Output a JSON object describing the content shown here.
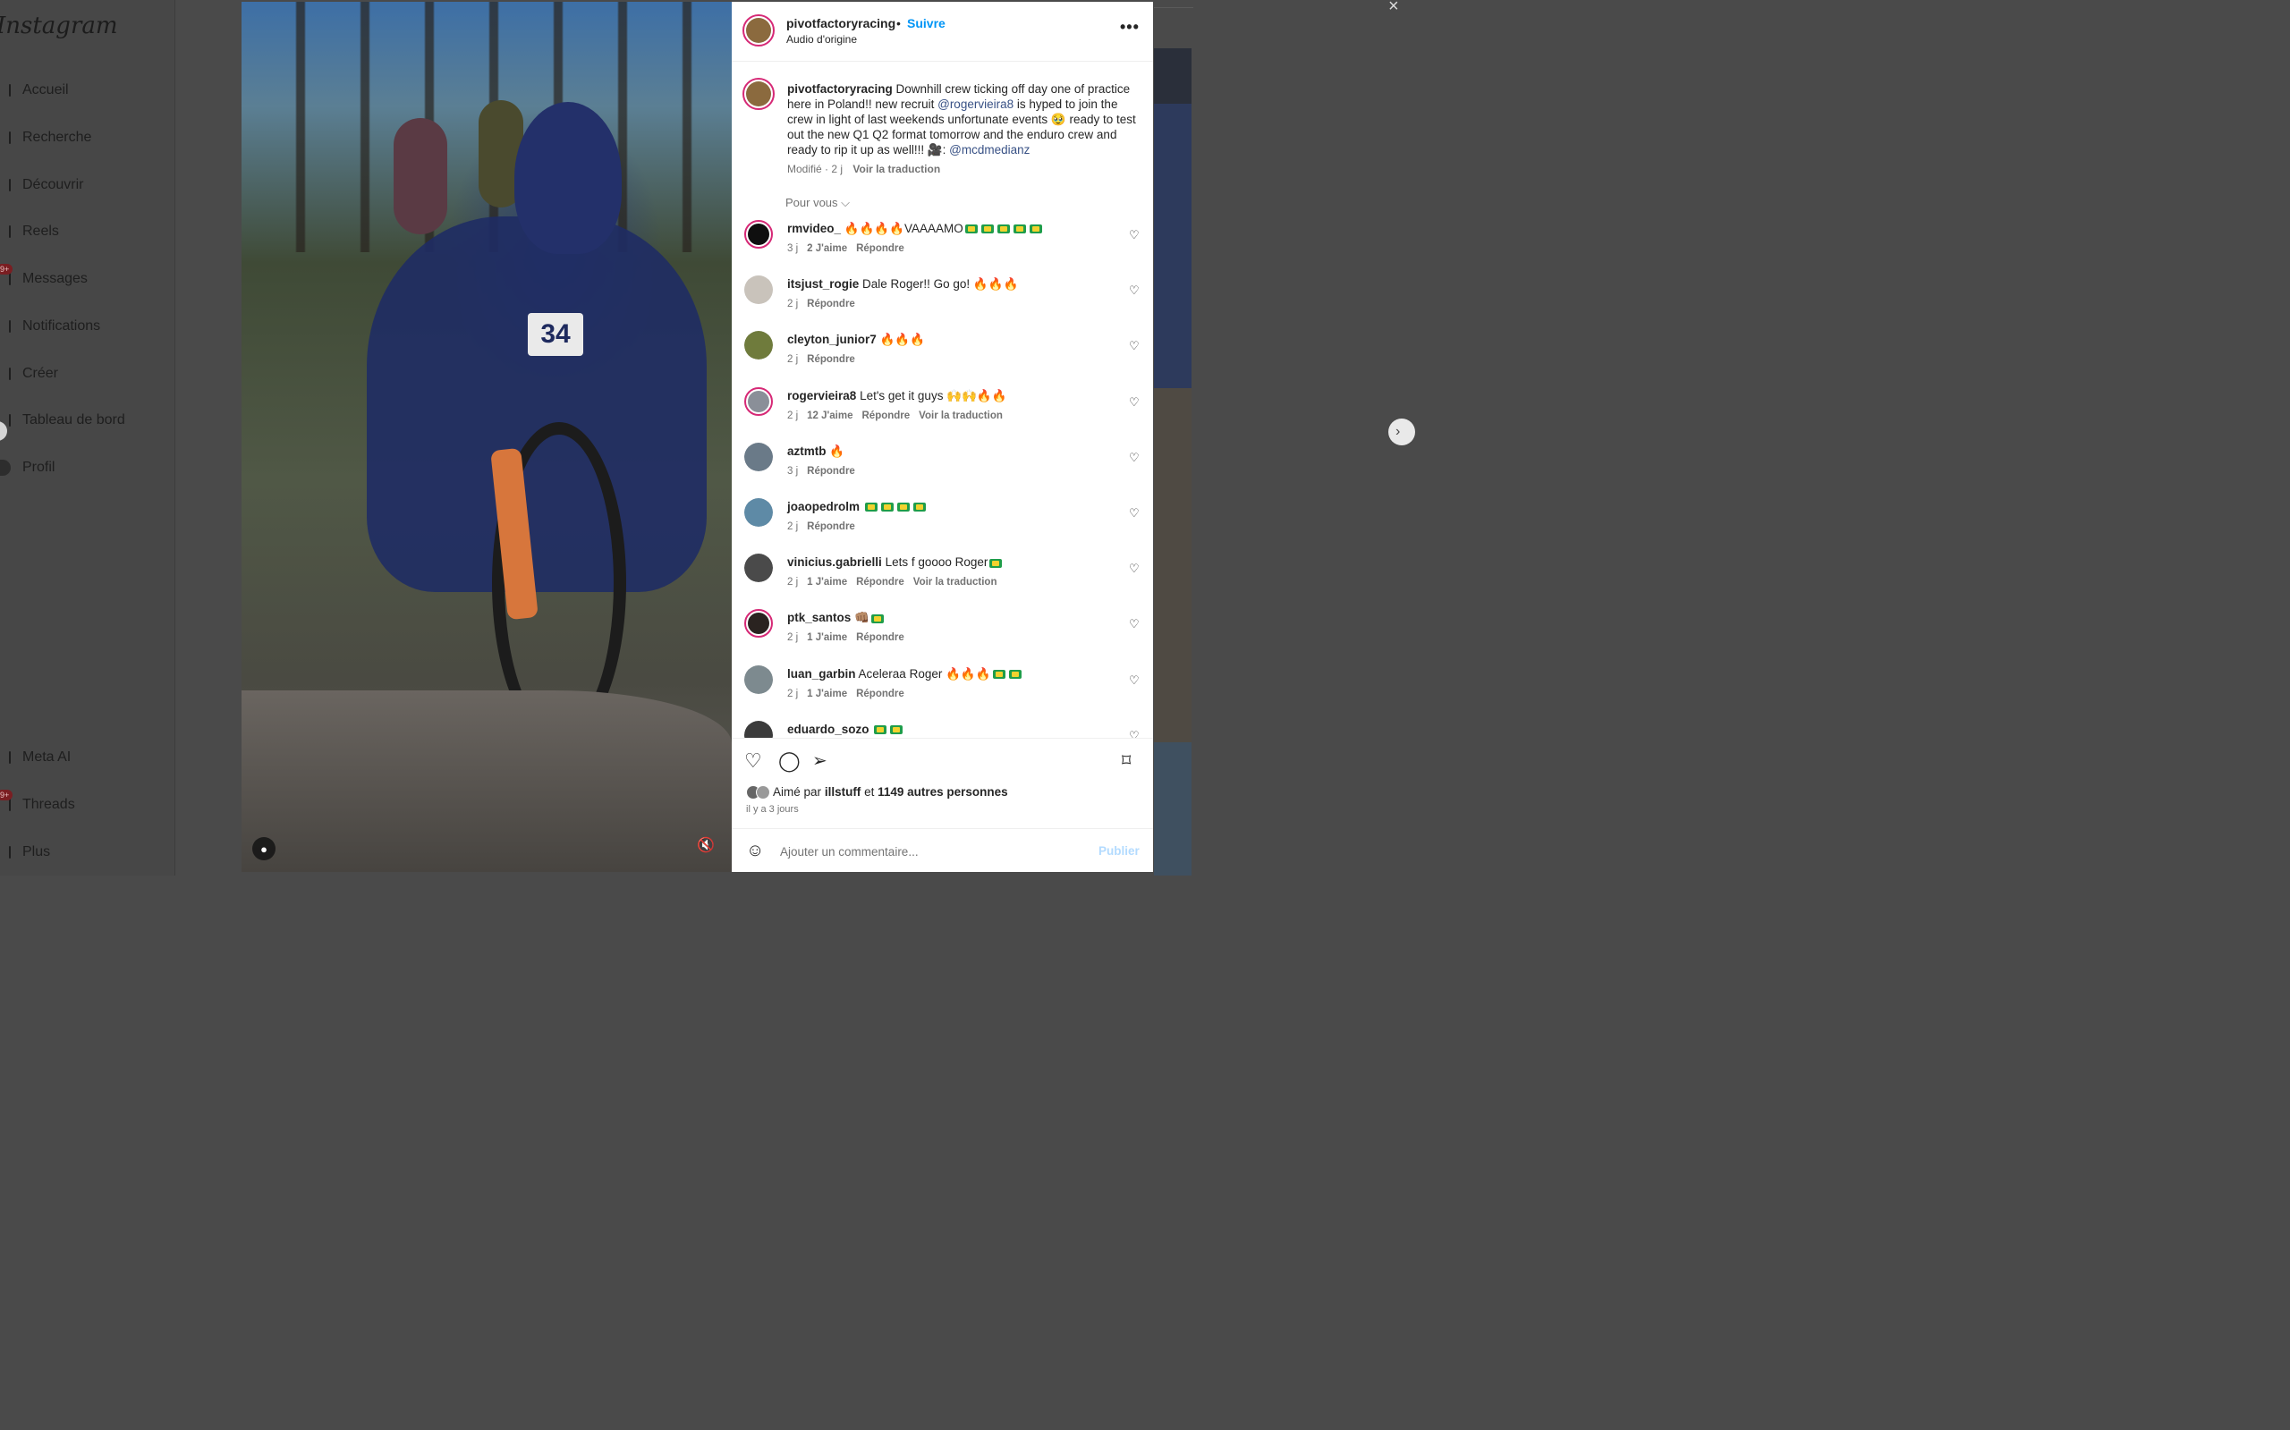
{
  "sidebar": {
    "logo": "Instagram",
    "items": [
      {
        "label": "Accueil",
        "icon": "home-icon"
      },
      {
        "label": "Recherche",
        "icon": "search-icon"
      },
      {
        "label": "Découvrir",
        "icon": "compass-icon"
      },
      {
        "label": "Reels",
        "icon": "reels-icon"
      },
      {
        "label": "Messages",
        "icon": "messenger-icon",
        "badge": "9+"
      },
      {
        "label": "Notifications",
        "icon": "heart-icon"
      },
      {
        "label": "Créer",
        "icon": "plus-square-icon"
      },
      {
        "label": "Tableau de bord",
        "icon": "dashboard-icon"
      },
      {
        "label": "Profil",
        "icon": "profile-avatar"
      },
      {
        "label": "Meta AI",
        "icon": "meta-ai-icon"
      },
      {
        "label": "Threads",
        "icon": "threads-icon",
        "badge": "9+"
      },
      {
        "label": "Plus",
        "icon": "menu-icon"
      }
    ]
  },
  "media": {
    "bib_number": "34"
  },
  "post": {
    "username": "pivotfactoryracing",
    "separator": "•",
    "follow_label": "Suivre",
    "audio": "Audio d'origine",
    "more_label": "•••",
    "caption": {
      "username": "pivotfactoryracing",
      "text_1": "Downhill crew ticking off day one of practice here in Poland!! new recruit",
      "mention_1": "@rogervieira8",
      "text_2": "is hyped to join the crew in light of last weekends unfortunate events 🥹 ready to test out the new Q1 Q2 format tomorrow and the enduro crew and ready to rip it up as well!!! 🎥:",
      "mention_2": "@mcdmedianz",
      "edited": "Modifié · 2 j",
      "translate": "Voir la traduction"
    },
    "sort_label": "Pour vous ⌵"
  },
  "comments": [
    {
      "user": "rmvideo_",
      "text": "🔥🔥🔥🔥VAAAAMO",
      "flags": 5,
      "time": "3 j",
      "likes": "2 J'aime",
      "reply": "Répondre",
      "translate": "",
      "avatar": "#0f0f0f"
    },
    {
      "user": "itsjust_rogie",
      "text": "Dale Roger!! Go go! 🔥🔥🔥",
      "flags": 0,
      "time": "2 j",
      "likes": "",
      "reply": "Répondre",
      "translate": "",
      "avatar": "#c9c3bb"
    },
    {
      "user": "cleyton_junior7",
      "text": "🔥🔥🔥",
      "flags": 0,
      "time": "2 j",
      "likes": "",
      "reply": "Répondre",
      "translate": "",
      "avatar": "#6f7b3c"
    },
    {
      "user": "rogervieira8",
      "text": "Let's get it guys 🙌🙌🔥🔥",
      "flags": 0,
      "time": "2 j",
      "likes": "12 J'aime",
      "reply": "Répondre",
      "translate": "Voir la traduction",
      "avatar": "#8a8f98"
    },
    {
      "user": "aztmtb",
      "text": "🔥",
      "flags": 0,
      "time": "3 j",
      "likes": "",
      "reply": "Répondre",
      "translate": "",
      "avatar": "#6a7a88"
    },
    {
      "user": "joaopedrolm",
      "text": "",
      "flags": 4,
      "time": "2 j",
      "likes": "",
      "reply": "Répondre",
      "translate": "",
      "avatar": "#5e8aa6"
    },
    {
      "user": "vinicius.gabrielli",
      "text": "Lets f goooo Roger",
      "flags": 1,
      "time": "2 j",
      "likes": "1 J'aime",
      "reply": "Répondre",
      "translate": "Voir la traduction",
      "avatar": "#4a4a4a"
    },
    {
      "user": "ptk_santos",
      "text": "👊🏽",
      "flags": 1,
      "time": "2 j",
      "likes": "1 J'aime",
      "reply": "Répondre",
      "translate": "",
      "avatar": "#2a2320"
    },
    {
      "user": "luan_garbin",
      "text": "Aceleraa Roger 🔥🔥🔥",
      "flags": 2,
      "time": "2 j",
      "likes": "1 J'aime",
      "reply": "Répondre",
      "translate": "",
      "avatar": "#7d8a8f"
    },
    {
      "user": "eduardo_sozo",
      "text": "",
      "flags": 2,
      "time": "",
      "likes": "",
      "reply": "",
      "translate": "",
      "avatar": "#3b3b3b"
    }
  ],
  "actions": {
    "liked_by_prefix": "Aimé par",
    "liked_by_user": "illstuff",
    "liked_by_connector": "et",
    "liked_by_others": "1149 autres personnes",
    "time_ago": "il y a 3 jours"
  },
  "comment_box": {
    "placeholder": "Ajouter un commentaire...",
    "publish_label": "Publier"
  },
  "colors": {
    "link_blue": "#0095f6",
    "mention_blue": "#385185",
    "story_ring": "#d62976",
    "publish_disabled": "#b3dbff"
  }
}
